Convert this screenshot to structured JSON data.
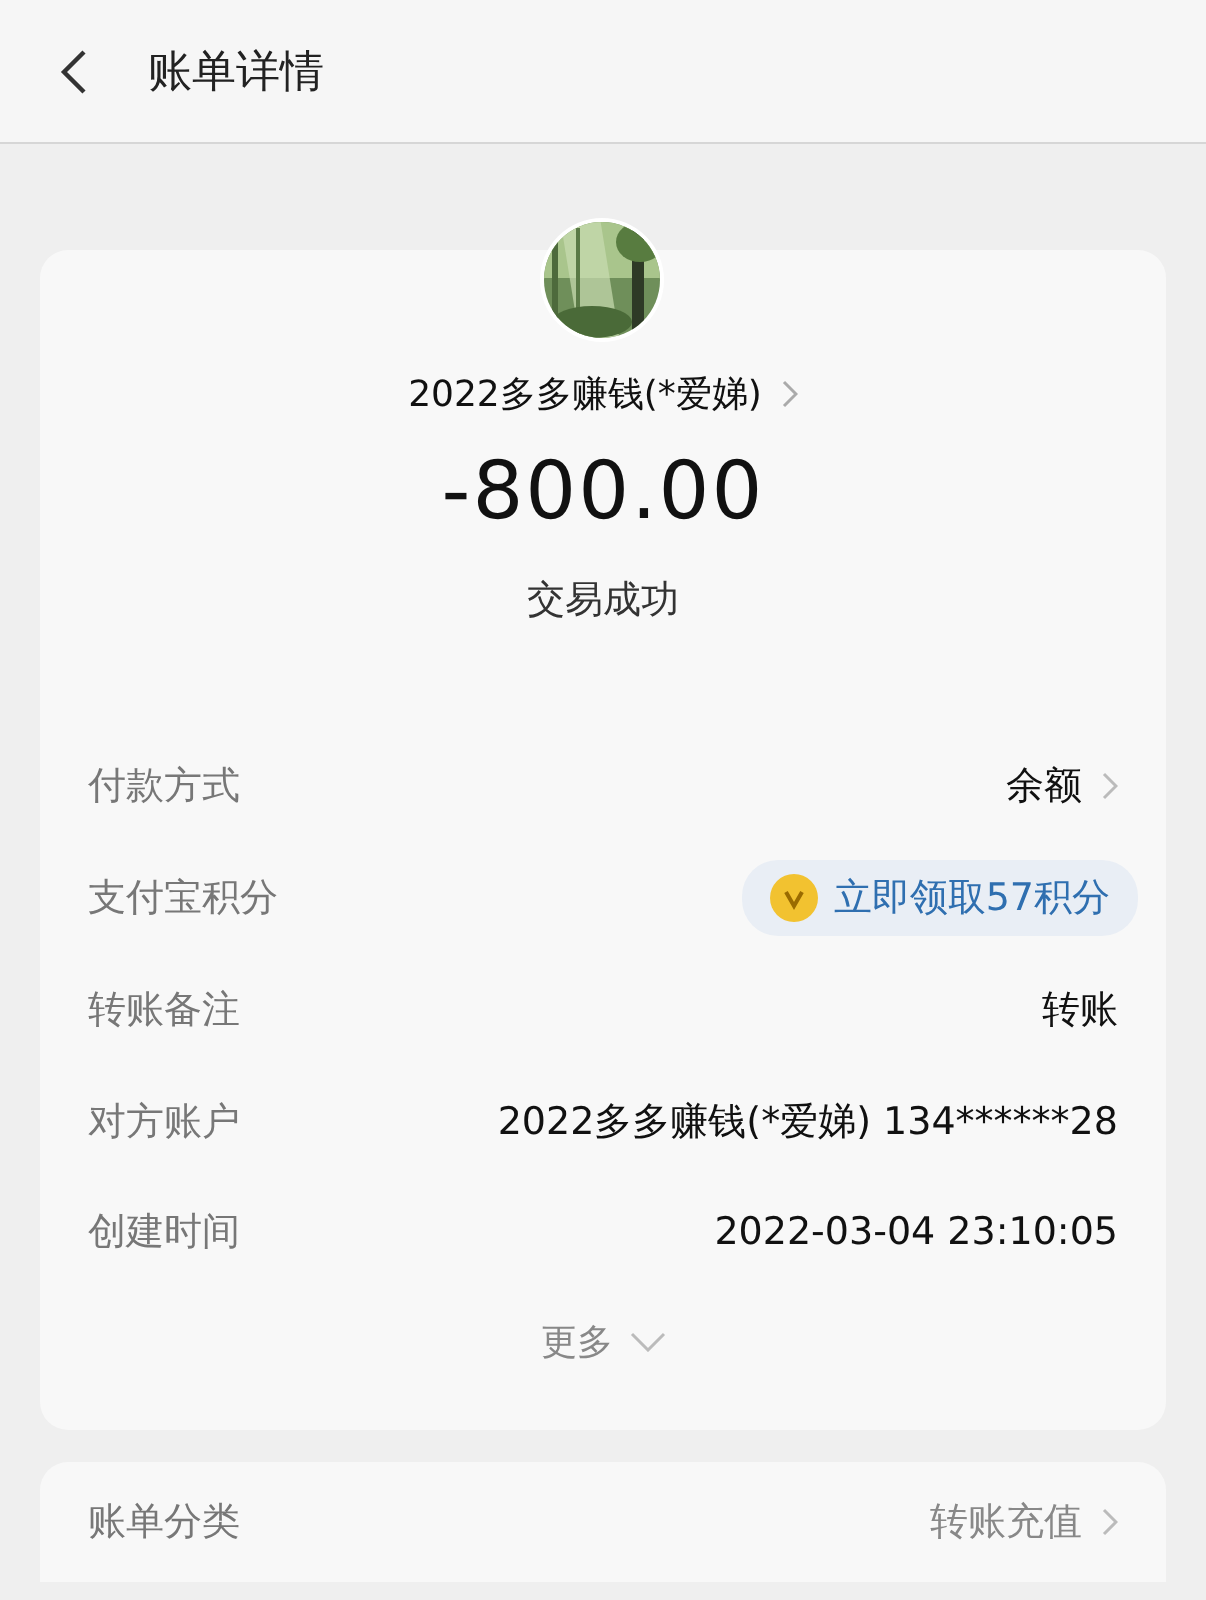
{
  "header": {
    "title": "账单详情"
  },
  "payee": {
    "name": "2022多多赚钱(*爱娣)",
    "amount": "-800.00",
    "status": "交易成功"
  },
  "details": [
    {
      "kind": "link",
      "label": "付款方式",
      "value": "余额"
    },
    {
      "kind": "points",
      "label": "支付宝积分",
      "value": "立即领取57积分"
    },
    {
      "kind": "text",
      "label": "转账备注",
      "value": "转账"
    },
    {
      "kind": "text",
      "label": "对方账户",
      "value": "2022多多赚钱(*爱娣) 134******28"
    },
    {
      "kind": "text",
      "label": "创建时间",
      "value": "2022-03-04 23:10:05"
    }
  ],
  "more": {
    "label": "更多"
  },
  "category": {
    "label": "账单分类",
    "value": "转账充值"
  }
}
